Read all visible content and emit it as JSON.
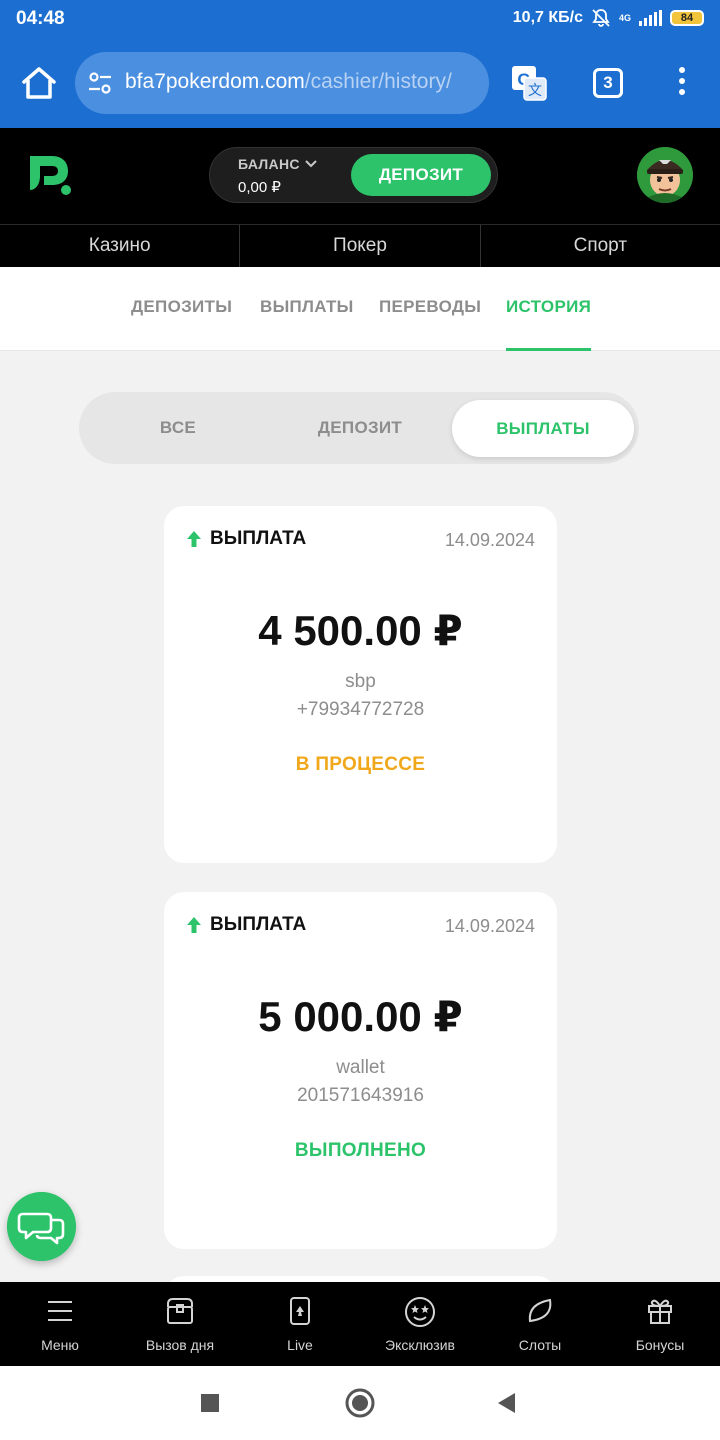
{
  "status_bar": {
    "time": "04:48",
    "net_speed": "10,7 КБ/с",
    "network": "4G",
    "battery": "84"
  },
  "browser": {
    "url_host": "bfa7pokerdom.com",
    "url_path": "/cashier/history/",
    "tab_count": "3"
  },
  "header": {
    "balance_label": "БАЛАНС",
    "balance_value": "0,00 ₽",
    "deposit_button": "ДЕПОЗИТ"
  },
  "sections": [
    "Казино",
    "Покер",
    "Спорт"
  ],
  "cashier_tabs": [
    "ДЕПОЗИТЫ",
    "ВЫПЛАТЫ",
    "ПЕРЕВОДЫ",
    "ИСТОРИЯ"
  ],
  "cashier_active_tab": "ИСТОРИЯ",
  "filter": {
    "options": [
      "ВСЕ",
      "ДЕПОЗИТ",
      "ВЫПЛАТЫ"
    ],
    "selected": "ВЫПЛАТЫ"
  },
  "transactions": [
    {
      "type": "ВЫПЛАТА",
      "date": "14.09.2024",
      "amount": "4 500.00 ₽",
      "method": "sbp",
      "account": "+79934772728",
      "status": "В ПРОЦЕССЕ",
      "status_color": "#f0a81a"
    },
    {
      "type": "ВЫПЛАТА",
      "date": "14.09.2024",
      "amount": "5 000.00 ₽",
      "method": "wallet",
      "account": "201571643916",
      "status": "ВЫПОЛНЕНО",
      "status_color": "#2dc36a"
    }
  ],
  "bottom_nav": [
    "Меню",
    "Вызов дня",
    "Live",
    "Эксклюзив",
    "Слоты",
    "Бонусы"
  ],
  "colors": {
    "brand_green": "#2dc36a",
    "browser_blue": "#1c6fd1",
    "pending_amber": "#f0a81a"
  }
}
